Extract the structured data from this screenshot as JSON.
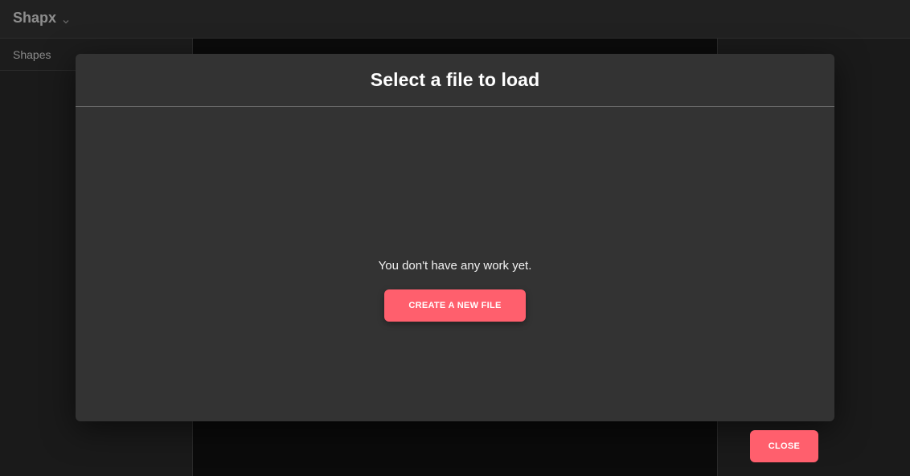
{
  "app": {
    "title": "Shapx",
    "menu_icon": "chevron-down-icon"
  },
  "sidebar": {
    "tabs": [
      {
        "label": "Shapes"
      }
    ]
  },
  "modal": {
    "title": "Select a file to load",
    "empty_message": "You don't have any work yet.",
    "create_button_label": "CREATE A NEW FILE",
    "close_button_label": "CLOSE"
  },
  "colors": {
    "accent": "#ff5f6d",
    "modal_background": "#333333",
    "topbar_background": "#2d2d2d"
  }
}
